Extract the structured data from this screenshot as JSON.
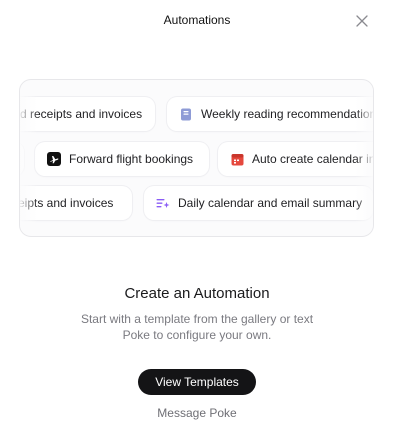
{
  "header": {
    "title": "Automations",
    "close_icon": "close-icon"
  },
  "gallery": {
    "rows": [
      {
        "chips": [
          {
            "label": "d receipts and invoices",
            "icon": "none"
          },
          {
            "label": "Weekly reading recommendations",
            "icon": "book-icon",
            "icon_color": "#8e9bd6"
          }
        ]
      },
      {
        "chips": [
          {
            "label": "",
            "icon": "none"
          },
          {
            "label": "Forward flight bookings",
            "icon": "airplane-icon",
            "icon_color": "#111111"
          },
          {
            "label": "Auto create calendar invites",
            "icon": "calendar-icon",
            "icon_color": "#e5483d"
          }
        ]
      },
      {
        "chips": [
          {
            "label": "ceipts and invoices",
            "icon": "none"
          },
          {
            "label": "Daily calendar and email summary",
            "icon": "list-sparkle-icon",
            "icon_color": "#8a5cf6"
          }
        ]
      }
    ]
  },
  "empty_state": {
    "heading": "Create an Automation",
    "subtitle": "Start with a template from the gallery or text Poke to configure your own.",
    "primary_button": "View Templates",
    "secondary_link": "Message Poke"
  },
  "colors": {
    "primary_button_bg": "#141416",
    "text_muted": "#7a7a80"
  }
}
